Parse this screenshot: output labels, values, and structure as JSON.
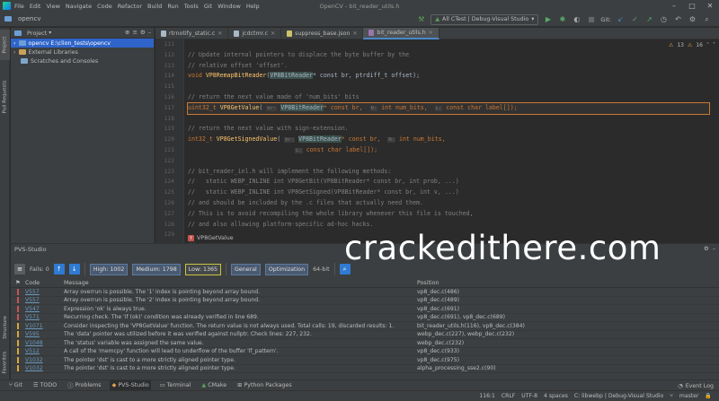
{
  "menu": [
    "File",
    "Edit",
    "View",
    "Navigate",
    "Code",
    "Refactor",
    "Build",
    "Run",
    "Tools",
    "Git",
    "Window",
    "Help"
  ],
  "window_title": "OpenCV - bit_reader_utils.h",
  "breadcrumb": "opencv",
  "toolbar": {
    "config": "All CTest | Debug-Visual Studio",
    "git_label": "Git:"
  },
  "side_tabs": {
    "project": "Project",
    "pull_requests": "Pull Requests",
    "structure": "Structure",
    "favorites": "Favorites"
  },
  "project": {
    "title": "Project",
    "tree": [
      {
        "label": "opencv  E:\\clion_tests\\opencv",
        "selected": true
      },
      {
        "label": "External Libraries",
        "selected": false
      },
      {
        "label": "Scratches and Consoles",
        "selected": false
      }
    ]
  },
  "editor_tabs": [
    {
      "label": "rtrnotify_static.c",
      "active": false
    },
    {
      "label": "jcdctmr.c",
      "active": false
    },
    {
      "label": "suppress_base.json",
      "active": false
    },
    {
      "label": "bit_reader_utils.h",
      "active": true
    }
  ],
  "editor": {
    "line_numbers": [
      "111",
      "112",
      "113",
      "114",
      "115",
      "116",
      "117",
      "118",
      "119",
      "120",
      "121",
      "122",
      "123",
      "124",
      "125",
      "126",
      "127",
      "128",
      "129"
    ],
    "warnings": {
      "warn_count": "13",
      "weak_count": "16"
    },
    "footer_function": "VP8GetValue",
    "lines": {
      "l112": "// Update internal pointers to displace the byte buffer by the",
      "l113": "// relative offset 'offset'.",
      "l114_a": "void ",
      "l114_fn": "VP8RemapBitReader",
      "l114_ty": "VP8BitReader",
      "l114_b": "* const br, ptrdiff_t offset);",
      "l116": "// return the next value made of 'num_bits' bits",
      "l117_a": "uint32_t ",
      "l117_fn": "VP8GetValue",
      "l117_h1": "br:",
      "l117_ty": "VP8BitReader",
      "l117_b": "* const br,  ",
      "l117_h2": "N:",
      "l117_c": " int num_bits,  ",
      "l117_h3": "L:",
      "l117_d": " const char label[]);",
      "l119": "// return the next value with sign-extension.",
      "l120_a": "int32_t ",
      "l120_fn": "VP8GetSignedValue",
      "l120_h1": "br:",
      "l120_ty": "VP8BitReader",
      "l120_b": "* const br,  ",
      "l120_h2": "N:",
      "l120_c": " int num_bits,",
      "l121_h": "L:",
      "l121_b": " const char label[]);",
      "l123": "// bit_reader_inl.h will implement the following methods:",
      "l124": "//   static WEBP_INLINE int VP8GetBit(VP8BitReader* const br, int prob, ...)",
      "l125": "//   static WEBP_INLINE int VP8GetSigned(VP8BitReader* const br, int v, ...)",
      "l126": "// and should be included by the .c files that actually need them.",
      "l127": "// This is to avoid recompiling the whole library whenever this file is touched,",
      "l128": "// and also allowing platform-specific ad-hoc hacks.",
      "l130": "// ---------------------------------------------------------------"
    }
  },
  "pvs": {
    "title": "PVS-Studio",
    "fails": "Fails: 0",
    "high": "High: 1002",
    "medium": "Medium: 1798",
    "low": "Low: 1365",
    "general": "General",
    "optimization": "Optimization",
    "bits": "64-bit",
    "columns": [
      "Code",
      "Message",
      "Position"
    ],
    "rows": [
      {
        "code": "V557",
        "sev": "high",
        "message": "Array overrun is possible. The '1' index is pointing beyond array bound.",
        "position": "vp8_dec.c(486)"
      },
      {
        "code": "V557",
        "sev": "high",
        "message": "Array overrun is possible. The '2' index is pointing beyond array bound.",
        "position": "vp8_dec.c(489)"
      },
      {
        "code": "V547",
        "sev": "high",
        "message": "Expression 'ok' is always true.",
        "position": "vp8_dec.c(691)"
      },
      {
        "code": "V571",
        "sev": "high",
        "message": "Recurring check. The 'if (ok)' condition was already verified in line 689.",
        "position": "vp8_dec.c(691), vp8_dec.c(689)"
      },
      {
        "code": "V1071",
        "sev": "med",
        "message": "Consider inspecting the 'VP8GetValue' function. The return value is not always used. Total calls: 19, discarded results: 1.",
        "position": "bit_reader_utils.h(116), vp8_dec.c(384)"
      },
      {
        "code": "V595",
        "sev": "med",
        "message": "The 'data' pointer was utilized before it was verified against nullptr. Check lines: 227, 232.",
        "position": "webp_dec.c(227), webp_dec.c(232)"
      },
      {
        "code": "V1048",
        "sev": "med",
        "message": "The 'status' variable was assigned the same value.",
        "position": "webp_dec.c(232)"
      },
      {
        "code": "V512",
        "sev": "med",
        "message": "A call of the 'memcpy' function will lead to underflow of the buffer 'lf_pattern'.",
        "position": "vp8_dec.c(933)"
      },
      {
        "code": "V1032",
        "sev": "med",
        "message": "The pointer 'dst' is cast to a more strictly aligned pointer type.",
        "position": "vp8_dec.c(975)"
      },
      {
        "code": "V1032",
        "sev": "med",
        "message": "The pointer 'dst' is cast to a more strictly aligned pointer type.",
        "position": "alpha_processing_sse2.c(90)"
      }
    ]
  },
  "bottom_tabs": [
    "Git",
    "TODO",
    "Problems",
    "PVS-Studio",
    "Terminal",
    "CMake",
    "Python Packages"
  ],
  "event_log": "Event Log",
  "status": {
    "pos": "116:1",
    "eol": "CRLF",
    "enc": "UTF-8",
    "indent": "4 spaces",
    "context": "C: libwebp | Debug-Visual Studio",
    "branch": "master"
  },
  "watermark": "crackedithere.com",
  "colors": {
    "accent": "#2f65ca",
    "high": "#c75450",
    "medium": "#d8a53a",
    "low": "#c9c43e"
  }
}
